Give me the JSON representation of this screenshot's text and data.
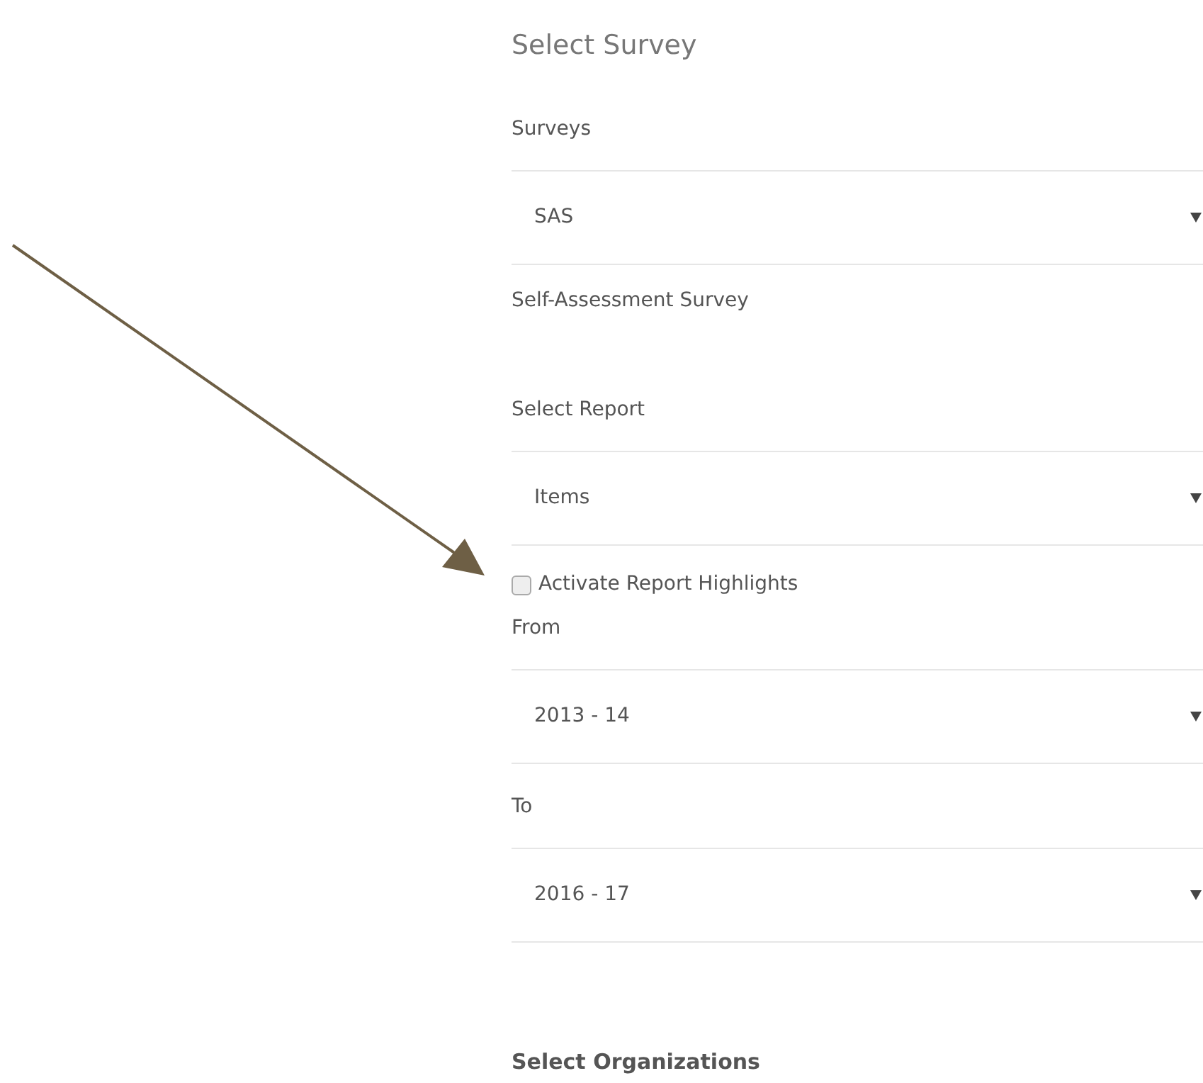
{
  "title": "Select Survey",
  "items": [
    {
      "kind": "label",
      "text": "Surveys"
    },
    {
      "kind": "select",
      "value": "SAS"
    },
    {
      "kind": "description",
      "text": "Self-Assessment Survey"
    },
    {
      "kind": "label",
      "text": "Select Report"
    },
    {
      "kind": "select",
      "value": "Items"
    },
    {
      "kind": "checkbox",
      "text": "Activate Report Highlights",
      "checked": false
    },
    {
      "kind": "label",
      "text": "From"
    },
    {
      "kind": "select",
      "value": "2013 - 14"
    },
    {
      "kind": "label",
      "text": "To"
    },
    {
      "kind": "select",
      "value": "2016 - 17"
    },
    {
      "kind": "heading",
      "text": "Select Organizations"
    }
  ]
}
